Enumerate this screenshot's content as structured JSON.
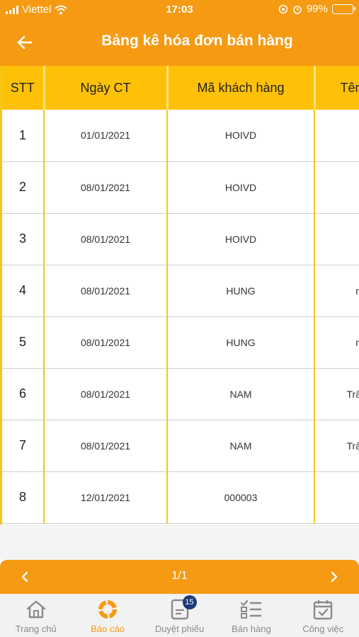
{
  "status_bar": {
    "carrier": "Viettel",
    "time": "17:03",
    "battery": "99%"
  },
  "header": {
    "title": "Bảng kê hóa đơn bán hàng"
  },
  "table": {
    "columns": [
      "STT",
      "Ngày CT",
      "Mã khách hàng",
      "Tên"
    ],
    "rows": [
      {
        "stt": "1",
        "date": "01/01/2021",
        "code": "HOIVD",
        "name": ""
      },
      {
        "stt": "2",
        "date": "08/01/2021",
        "code": "HOIVD",
        "name": ""
      },
      {
        "stt": "3",
        "date": "08/01/2021",
        "code": "HOIVD",
        "name": ""
      },
      {
        "stt": "4",
        "date": "08/01/2021",
        "code": "HUNG",
        "name": "n"
      },
      {
        "stt": "5",
        "date": "08/01/2021",
        "code": "HUNG",
        "name": "n"
      },
      {
        "stt": "6",
        "date": "08/01/2021",
        "code": "NAM",
        "name": "Trâ"
      },
      {
        "stt": "7",
        "date": "08/01/2021",
        "code": "NAM",
        "name": "Trâ"
      },
      {
        "stt": "8",
        "date": "12/01/2021",
        "code": "000003",
        "name": ""
      }
    ]
  },
  "pager": {
    "indicator": "1/1"
  },
  "bottom_nav": {
    "items": [
      {
        "label": "Trang chủ",
        "icon": "home-icon"
      },
      {
        "label": "Báo cáo",
        "icon": "report-icon",
        "active": true
      },
      {
        "label": "Duyệt phiếu",
        "icon": "approve-doc-icon",
        "badge": "15"
      },
      {
        "label": "Bán hàng",
        "icon": "sales-list-icon"
      },
      {
        "label": "Công việc",
        "icon": "calendar-task-icon"
      }
    ]
  },
  "colors": {
    "primary": "#f59a12",
    "table_header": "#ffc107",
    "badge": "#1d3a78",
    "nav_inactive": "#8a8a8a"
  }
}
